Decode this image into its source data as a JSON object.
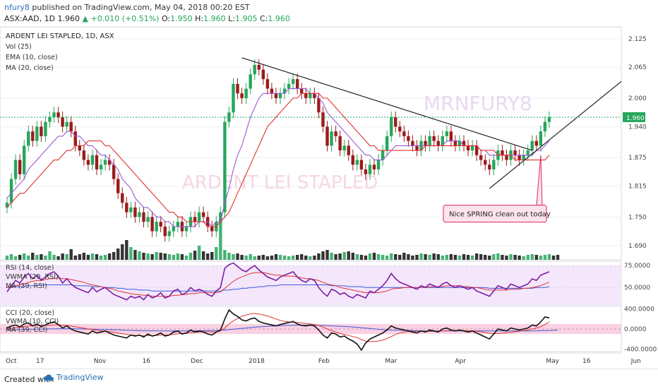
{
  "header": {
    "publisher": "nfury8",
    "published_text": "published on TradingView.com, May 04, 2018 00:20 EST",
    "symbol": "ASX:AAD, 1D",
    "last": "1.960",
    "change": "▲ +0.010 (+0.51%)",
    "o_label": "O:",
    "o_value": "1.950",
    "h_label": "H:",
    "h_value": "1.960",
    "l_label": "L:",
    "l_value": "1.905",
    "c_label": "C:",
    "c_value": "1.960"
  },
  "footer": {
    "created_with": "Created with",
    "brand": "TradingView"
  },
  "colors": {
    "up": "#26a65b",
    "down": "#9b1b1b",
    "ema": "#9b59d6",
    "ma": "#e0332f",
    "trendline": "#222222",
    "rsi": "#7b1fa2",
    "cci": "#111111",
    "price_label": "#26a65b",
    "annotation_border": "#e0245e",
    "annotation_fill": "#fce4ec"
  },
  "chart_data": [
    {
      "type": "candlestick",
      "title": "ARDENT LEI STAPLED, 1D, ASX",
      "legend": [
        "Vol (25)",
        "EMA (10, close)",
        "MA (20, close)"
      ],
      "watermark_symbol": "MRNFURY8",
      "watermark_name": "ARDENT LEI STAPLED",
      "y_ticks": [
        "2.125",
        "2.065",
        "2.000",
        "1.940",
        "1.875",
        "1.815",
        "1.750",
        "1.690"
      ],
      "ylim": [
        1.66,
        2.15
      ],
      "last_price_label": "1.960",
      "x_labels": [
        "Oct",
        "17",
        "Nov",
        "16",
        "Dec",
        "2018",
        "Feb",
        "Mar",
        "Apr",
        "May",
        "16",
        "Jun"
      ],
      "annotation": "Nice SPRING clean out today",
      "close": [
        1.78,
        1.83,
        1.87,
        1.84,
        1.9,
        1.93,
        1.91,
        1.94,
        1.92,
        1.95,
        1.96,
        1.97,
        1.96,
        1.94,
        1.95,
        1.93,
        1.9,
        1.89,
        1.87,
        1.86,
        1.88,
        1.85,
        1.86,
        1.87,
        1.86,
        1.83,
        1.8,
        1.78,
        1.76,
        1.77,
        1.75,
        1.76,
        1.74,
        1.75,
        1.72,
        1.74,
        1.73,
        1.71,
        1.72,
        1.73,
        1.74,
        1.72,
        1.73,
        1.75,
        1.74,
        1.76,
        1.75,
        1.73,
        1.72,
        1.74,
        1.76,
        1.95,
        1.97,
        2.03,
        2.01,
        2.0,
        2.02,
        2.05,
        2.07,
        2.06,
        2.04,
        2.02,
        2.01,
        2.0,
        2.01,
        2.02,
        2.03,
        2.04,
        2.02,
        2.01,
        2.0,
        2.01,
        2.0,
        1.97,
        1.94,
        1.9,
        1.93,
        1.92,
        1.89,
        1.9,
        1.88,
        1.86,
        1.87,
        1.85,
        1.84,
        1.86,
        1.85,
        1.87,
        1.89,
        1.92,
        1.96,
        1.94,
        1.93,
        1.92,
        1.91,
        1.9,
        1.89,
        1.91,
        1.9,
        1.92,
        1.91,
        1.9,
        1.92,
        1.93,
        1.91,
        1.9,
        1.91,
        1.9,
        1.89,
        1.9,
        1.88,
        1.87,
        1.86,
        1.85,
        1.87,
        1.89,
        1.88,
        1.87,
        1.89,
        1.88,
        1.87,
        1.88,
        1.89,
        1.91,
        1.9,
        1.93,
        1.95,
        1.96
      ],
      "volume": [
        6,
        8,
        5,
        7,
        9,
        6,
        10,
        7,
        8,
        6,
        12,
        7,
        5,
        9,
        8,
        15,
        6,
        8,
        10,
        7,
        9,
        8,
        6,
        7,
        9,
        11,
        16,
        22,
        28,
        18,
        14,
        12,
        10,
        9,
        8,
        11,
        10,
        9,
        8,
        7,
        9,
        8,
        6,
        10,
        13,
        20,
        12,
        9,
        11,
        18,
        60,
        14,
        10,
        8,
        9,
        7,
        6,
        8,
        5,
        6,
        7,
        5,
        6,
        8,
        7,
        6,
        5,
        6,
        7,
        8,
        6,
        5,
        6,
        9,
        12,
        14,
        10,
        8,
        9,
        11,
        12,
        10,
        8,
        7,
        6,
        9,
        10,
        8,
        7,
        6,
        9,
        8,
        7,
        10,
        8,
        6,
        7,
        9,
        8,
        7,
        9,
        8,
        6,
        7,
        8,
        7,
        6,
        8,
        7,
        6,
        9,
        8,
        7,
        6,
        8,
        9,
        7,
        6,
        8,
        7,
        6,
        5,
        7,
        8,
        7,
        6,
        7,
        8,
        6,
        7
      ],
      "ema10": [
        1.79,
        1.8,
        1.81,
        1.82,
        1.83,
        1.85,
        1.86,
        1.87,
        1.88,
        1.89,
        1.9,
        1.91,
        1.92,
        1.92,
        1.93,
        1.93,
        1.92,
        1.92,
        1.91,
        1.9,
        1.9,
        1.89,
        1.88,
        1.88,
        1.87,
        1.86,
        1.85,
        1.83,
        1.82,
        1.81,
        1.79,
        1.78,
        1.77,
        1.77,
        1.76,
        1.75,
        1.75,
        1.74,
        1.74,
        1.73,
        1.73,
        1.73,
        1.73,
        1.73,
        1.73,
        1.74,
        1.74,
        1.74,
        1.73,
        1.74,
        1.74,
        1.78,
        1.81,
        1.85,
        1.88,
        1.9,
        1.93,
        1.96,
        1.98,
        2.0,
        2.01,
        2.01,
        2.01,
        2.01,
        2.01,
        2.01,
        2.02,
        2.02,
        2.02,
        2.02,
        2.02,
        2.01,
        2.01,
        2.0,
        1.99,
        1.97,
        1.96,
        1.95,
        1.94,
        1.93,
        1.92,
        1.91,
        1.9,
        1.89,
        1.88,
        1.88,
        1.87,
        1.87,
        1.87,
        1.88,
        1.89,
        1.9,
        1.9,
        1.9,
        1.9,
        1.9,
        1.9,
        1.9,
        1.9,
        1.9,
        1.9,
        1.9,
        1.9,
        1.91,
        1.91,
        1.91,
        1.91,
        1.9,
        1.9,
        1.9,
        1.9,
        1.89,
        1.89,
        1.88,
        1.88,
        1.88,
        1.88,
        1.88,
        1.88,
        1.88,
        1.88,
        1.88,
        1.88,
        1.88,
        1.89,
        1.89,
        1.9,
        1.91
      ],
      "ma20": [
        1.77,
        1.78,
        1.79,
        1.8,
        1.8,
        1.81,
        1.82,
        1.83,
        1.84,
        1.85,
        1.86,
        1.87,
        1.87,
        1.88,
        1.89,
        1.89,
        1.9,
        1.9,
        1.9,
        1.91,
        1.91,
        1.91,
        1.91,
        1.9,
        1.9,
        1.89,
        1.88,
        1.87,
        1.86,
        1.85,
        1.84,
        1.83,
        1.82,
        1.81,
        1.8,
        1.79,
        1.78,
        1.77,
        1.76,
        1.76,
        1.75,
        1.75,
        1.74,
        1.74,
        1.74,
        1.74,
        1.74,
        1.73,
        1.73,
        1.73,
        1.74,
        1.75,
        1.76,
        1.78,
        1.8,
        1.82,
        1.84,
        1.86,
        1.88,
        1.9,
        1.92,
        1.94,
        1.95,
        1.96,
        1.97,
        1.98,
        1.99,
        2.0,
        2.0,
        2.01,
        2.01,
        2.01,
        2.01,
        2.01,
        2.0,
        2.0,
        1.99,
        1.98,
        1.97,
        1.96,
        1.95,
        1.94,
        1.93,
        1.92,
        1.91,
        1.9,
        1.9,
        1.89,
        1.89,
        1.89,
        1.89,
        1.89,
        1.89,
        1.89,
        1.89,
        1.89,
        1.89,
        1.89,
        1.9,
        1.9,
        1.9,
        1.9,
        1.9,
        1.9,
        1.9,
        1.9,
        1.9,
        1.9,
        1.9,
        1.9,
        1.9,
        1.89,
        1.89,
        1.89,
        1.89,
        1.88,
        1.88,
        1.88,
        1.88,
        1.87,
        1.87,
        1.87,
        1.87,
        1.87,
        1.87,
        1.87,
        1.87,
        1.88
      ]
    },
    {
      "type": "line",
      "legend": [
        "RSI (14, close)",
        "VWMA (20, RSI)",
        "MA (39, RSI)"
      ],
      "y_ticks": [
        "75.0000",
        "50.0000"
      ],
      "ylim": [
        30,
        80
      ],
      "rsi": [
        45,
        52,
        58,
        55,
        62,
        66,
        60,
        64,
        58,
        62,
        66,
        68,
        63,
        55,
        60,
        54,
        50,
        48,
        46,
        44,
        50,
        45,
        48,
        50,
        46,
        42,
        40,
        38,
        36,
        40,
        38,
        40,
        36,
        42,
        38,
        40,
        44,
        38,
        40,
        46,
        48,
        42,
        44,
        50,
        46,
        48,
        46,
        42,
        40,
        46,
        50,
        72,
        76,
        78,
        74,
        70,
        68,
        72,
        75,
        70,
        66,
        62,
        60,
        58,
        62,
        64,
        66,
        68,
        62,
        58,
        56,
        60,
        58,
        50,
        44,
        40,
        48,
        46,
        42,
        44,
        40,
        38,
        42,
        40,
        38,
        46,
        44,
        48,
        52,
        58,
        66,
        60,
        56,
        54,
        52,
        50,
        48,
        52,
        50,
        54,
        52,
        50,
        54,
        56,
        52,
        50,
        52,
        50,
        48,
        50,
        46,
        44,
        42,
        40,
        46,
        52,
        50,
        48,
        54,
        52,
        50,
        52,
        54,
        60,
        58,
        64,
        66,
        68
      ],
      "vwma": [
        50,
        51,
        52,
        53,
        54,
        56,
        57,
        58,
        58,
        59,
        60,
        60,
        61,
        60,
        60,
        59,
        58,
        57,
        56,
        54,
        53,
        52,
        51,
        50,
        49,
        48,
        46,
        45,
        44,
        43,
        42,
        42,
        41,
        41,
        40,
        40,
        40,
        40,
        40,
        41,
        41,
        42,
        42,
        43,
        43,
        44,
        44,
        44,
        44,
        44,
        45,
        49,
        53,
        57,
        60,
        62,
        64,
        66,
        67,
        67,
        67,
        66,
        65,
        64,
        64,
        63,
        63,
        63,
        62,
        61,
        60,
        60,
        59,
        58,
        56,
        54,
        53,
        52,
        50,
        49,
        48,
        47,
        46,
        45,
        44,
        44,
        44,
        44,
        45,
        46,
        48,
        49,
        49,
        50,
        50,
        50,
        50,
        50,
        50,
        51,
        51,
        51,
        51,
        52,
        52,
        52,
        52,
        51,
        51,
        50,
        50,
        49,
        48,
        47,
        47,
        47,
        47,
        47,
        48,
        48,
        48,
        49,
        49,
        50,
        51,
        52,
        54,
        56
      ],
      "ma39": [
        50,
        50,
        51,
        51,
        51,
        52,
        52,
        52,
        53,
        53,
        53,
        53,
        53,
        53,
        53,
        53,
        52,
        52,
        52,
        52,
        51,
        51,
        51,
        50,
        50,
        50,
        49,
        49,
        48,
        48,
        48,
        47,
        47,
        47,
        46,
        46,
        46,
        46,
        46,
        46,
        46,
        46,
        46,
        46,
        46,
        46,
        46,
        46,
        46,
        46,
        46,
        47,
        47,
        48,
        48,
        49,
        49,
        50,
        50,
        51,
        51,
        52,
        52,
        52,
        53,
        53,
        53,
        53,
        53,
        53,
        53,
        53,
        53,
        53,
        53,
        53,
        52,
        52,
        52,
        52,
        51,
        51,
        51,
        51,
        50,
        50,
        50,
        50,
        50,
        50,
        50,
        50,
        50,
        50,
        50,
        50,
        50,
        50,
        50,
        50,
        50,
        50,
        50,
        50,
        50,
        50,
        50,
        50,
        50,
        50,
        50,
        50,
        50,
        49,
        49,
        49,
        49,
        49,
        49,
        49,
        49,
        49,
        49,
        49,
        50,
        50,
        50,
        51
      ]
    },
    {
      "type": "line",
      "legend": [
        "CCI (20, close)",
        "VWMA (10, CCI)",
        "MA (39, CCI)"
      ],
      "y_ticks": [
        "400.0000",
        "0.0000",
        "-400.0000"
      ],
      "ylim": [
        -450,
        450
      ],
      "cci": [
        20,
        60,
        80,
        40,
        100,
        120,
        60,
        100,
        50,
        80,
        120,
        140,
        90,
        20,
        60,
        0,
        -40,
        -60,
        -80,
        -100,
        -40,
        -80,
        -60,
        -40,
        -80,
        -120,
        -140,
        -160,
        -180,
        -120,
        -140,
        -120,
        -160,
        -100,
        -140,
        -120,
        -80,
        -140,
        -120,
        -60,
        -40,
        -100,
        -80,
        -20,
        -60,
        -40,
        -60,
        -100,
        -120,
        -60,
        -20,
        200,
        380,
        300,
        250,
        180,
        160,
        200,
        220,
        150,
        120,
        100,
        80,
        60,
        90,
        110,
        130,
        150,
        100,
        70,
        60,
        80,
        60,
        -20,
        -120,
        -180,
        -80,
        -100,
        -160,
        -140,
        -200,
        -240,
        -300,
        -420,
        -280,
        -200,
        -160,
        -120,
        -80,
        -20,
        60,
        20,
        0,
        -20,
        -40,
        -60,
        -80,
        -40,
        -60,
        -20,
        -40,
        -60,
        0,
        20,
        -20,
        -40,
        -20,
        -40,
        -60,
        -40,
        -80,
        -120,
        -160,
        -200,
        -100,
        0,
        -20,
        -40,
        20,
        0,
        -20,
        0,
        20,
        80,
        60,
        140,
        240,
        220
      ],
      "vwma": [
        0,
        10,
        25,
        35,
        50,
        60,
        65,
        70,
        70,
        72,
        75,
        80,
        80,
        75,
        70,
        60,
        45,
        30,
        15,
        0,
        -10,
        -25,
        -35,
        -45,
        -55,
        -65,
        -80,
        -95,
        -110,
        -120,
        -125,
        -130,
        -135,
        -130,
        -130,
        -128,
        -120,
        -118,
        -115,
        -105,
        -95,
        -90,
        -85,
        -75,
        -68,
        -60,
        -55,
        -55,
        -58,
        -60,
        -40,
        20,
        100,
        160,
        210,
        250,
        280,
        300,
        310,
        300,
        280,
        260,
        230,
        200,
        170,
        150,
        140,
        135,
        130,
        120,
        110,
        100,
        90,
        70,
        40,
        0,
        -30,
        -60,
        -90,
        -110,
        -130,
        -150,
        -170,
        -210,
        -240,
        -250,
        -250,
        -240,
        -220,
        -190,
        -150,
        -110,
        -80,
        -60,
        -50,
        -45,
        -45,
        -45,
        -48,
        -48,
        -48,
        -45,
        -40,
        -35,
        -32,
        -30,
        -30,
        -32,
        -35,
        -38,
        -45,
        -55,
        -70,
        -85,
        -95,
        -90,
        -85,
        -78,
        -65,
        -55,
        -45,
        -30,
        -20,
        0,
        20,
        45,
        90,
        140
      ],
      "ma39": [
        -20,
        -18,
        -15,
        -12,
        -10,
        -8,
        -6,
        -4,
        -2,
        0,
        2,
        4,
        5,
        5,
        5,
        4,
        3,
        2,
        0,
        -2,
        -4,
        -6,
        -8,
        -10,
        -12,
        -15,
        -18,
        -22,
        -25,
        -28,
        -30,
        -32,
        -34,
        -35,
        -36,
        -37,
        -38,
        -38,
        -38,
        -38,
        -38,
        -38,
        -38,
        -37,
        -36,
        -35,
        -34,
        -33,
        -32,
        -30,
        -26,
        -20,
        -12,
        -4,
        4,
        12,
        20,
        28,
        36,
        42,
        48,
        54,
        58,
        62,
        66,
        70,
        72,
        74,
        76,
        76,
        76,
        75,
        74,
        72,
        70,
        66,
        62,
        58,
        54,
        50,
        45,
        40,
        34,
        26,
        18,
        10,
        2,
        -6,
        -12,
        -18,
        -22,
        -24,
        -26,
        -28,
        -30,
        -32,
        -34,
        -36,
        -38,
        -40,
        -40,
        -40,
        -40,
        -40,
        -40,
        -40,
        -40,
        -40,
        -40,
        -40,
        -40,
        -40,
        -40,
        -40,
        -40,
        -40,
        -40,
        -40,
        -40,
        -40,
        -40,
        -40,
        -40,
        -38,
        -36,
        -34,
        -32,
        -30,
        -26,
        -22
      ]
    }
  ]
}
